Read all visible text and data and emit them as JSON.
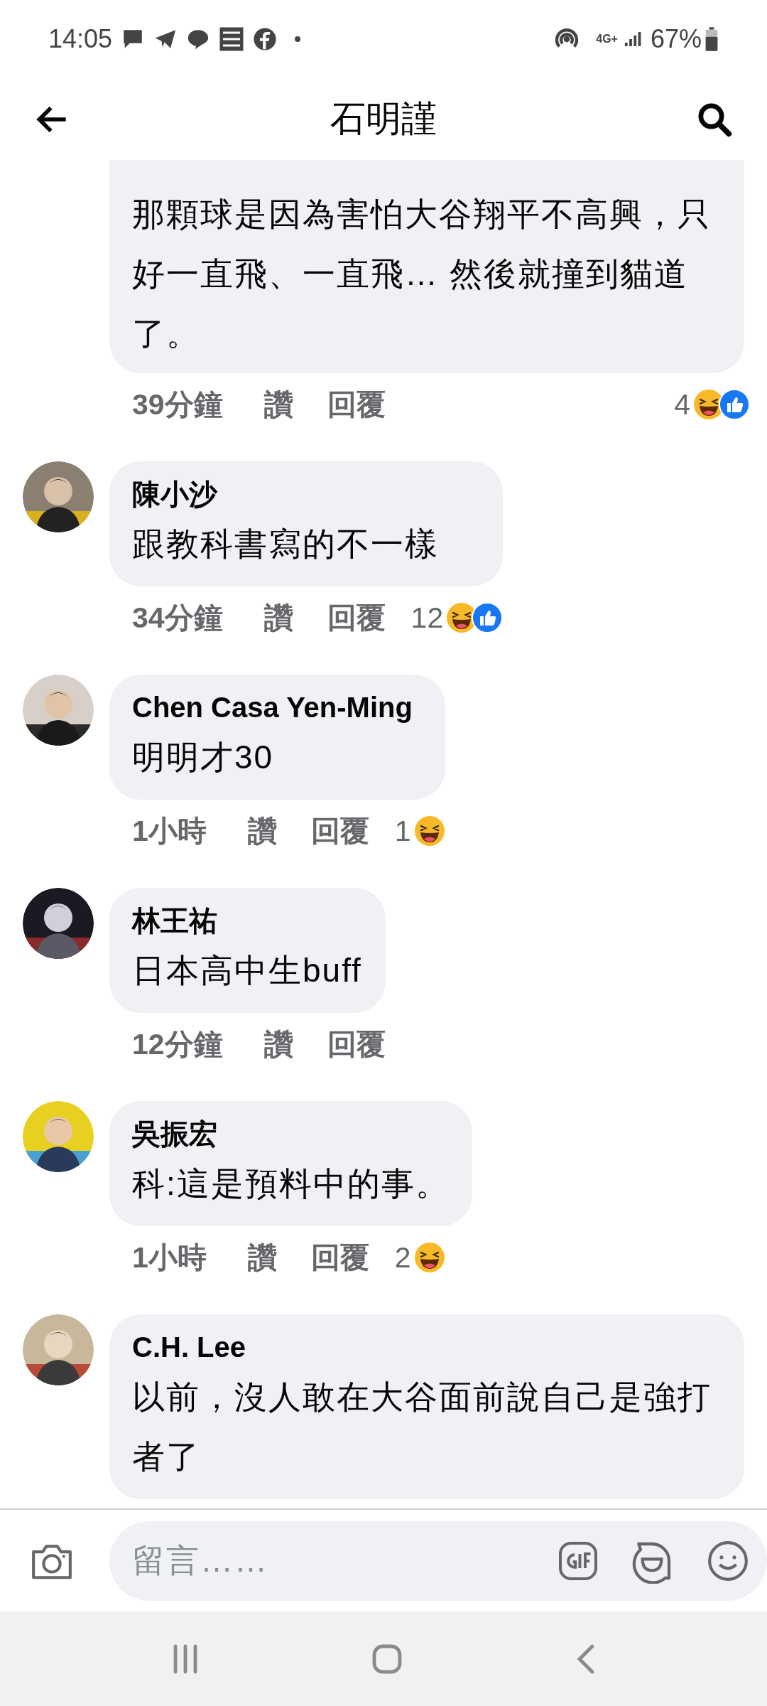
{
  "status_bar": {
    "time": "14:05",
    "network": "4G+",
    "battery": "67%"
  },
  "header": {
    "title": "石明謹"
  },
  "comments": [
    {
      "kind": "continued",
      "text": "那顆球是因為害怕大谷翔平不高興，只好一直飛、一直飛… 然後就撞到貓道了。",
      "time": "39分鐘",
      "like": "讚",
      "reply": "回覆",
      "reaction_count": "4",
      "reactions": [
        {
          "kind": "haha"
        },
        {
          "kind": "like"
        }
      ]
    },
    {
      "kind": "full",
      "name": "陳小沙",
      "text": "跟教科書寫的不一樣",
      "time": "34分鐘",
      "like": "讚",
      "reply": "回覆",
      "reaction_count": "12",
      "reactions": [
        {
          "kind": "haha"
        },
        {
          "kind": "like"
        }
      ]
    },
    {
      "kind": "full",
      "name": "Chen Casa Yen-Ming",
      "text": "明明才30",
      "time": "1小時",
      "like": "讚",
      "reply": "回覆",
      "reaction_count": "1",
      "reactions": [
        {
          "kind": "haha"
        }
      ]
    },
    {
      "kind": "full",
      "name": "林王祐",
      "text": "日本高中生buff",
      "time": "12分鐘",
      "like": "讚",
      "reply": "回覆"
    },
    {
      "kind": "full",
      "name": "吳振宏",
      "text": "科:這是預料中的事。",
      "time": "1小時",
      "like": "讚",
      "reply": "回覆",
      "reaction_count": "2",
      "reactions": [
        {
          "kind": "haha"
        }
      ]
    },
    {
      "kind": "full",
      "name": "C.H. Lee",
      "text": "以前，沒人敢在大谷面前說自己是強打者了"
    }
  ],
  "composer": {
    "placeholder": "留言……"
  }
}
